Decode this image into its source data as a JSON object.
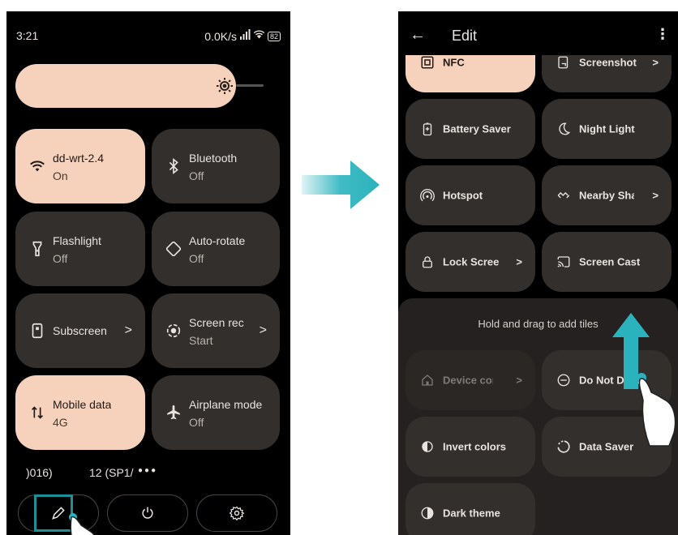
{
  "left_panel": {
    "status_time": "3:21",
    "status_speed": "0.0K/s",
    "battery": "82",
    "tiles": [
      {
        "title": "dd-wrt-2.4",
        "subtitle": "On",
        "icon": "wifi-icon",
        "active": true
      },
      {
        "title": "Bluetooth",
        "subtitle": "Off",
        "icon": "bluetooth-icon",
        "active": false
      },
      {
        "title": "Flashlight",
        "subtitle": "Off",
        "icon": "flashlight-icon",
        "active": false
      },
      {
        "title": "Auto-rotate",
        "subtitle": "Off",
        "icon": "auto-rotate-icon",
        "active": false
      },
      {
        "title": "Subscreen",
        "subtitle": "",
        "icon": "subscreen-icon",
        "active": false,
        "chevron": ">"
      },
      {
        "title": "Screen rec",
        "subtitle": "Start",
        "icon": "screen-record-icon",
        "active": false,
        "chevron": ">"
      },
      {
        "title": "Mobile data",
        "subtitle": "4G",
        "icon": "mobile-data-icon",
        "active": true
      },
      {
        "title": "Airplane mode",
        "subtitle": "Off",
        "icon": "airplane-icon",
        "active": false
      }
    ],
    "build_info_left": ")016)",
    "build_info_right": "12 (SP1/",
    "page_dots": "●●●"
  },
  "arrow_color": "#2bb3bd",
  "right_panel": {
    "title": "Edit",
    "back_icon": "back-arrow-icon",
    "menu_icon": "more-vert-icon",
    "tiles_active": [
      {
        "label": "NFC",
        "icon": "nfc-icon",
        "active": true
      },
      {
        "label": "Screenshot",
        "icon": "screenshot-icon",
        "chevron": ">"
      },
      {
        "label": "Battery Saver",
        "icon": "battery-saver-icon"
      },
      {
        "label": "Night Light",
        "icon": "night-light-icon"
      },
      {
        "label": "Hotspot",
        "icon": "hotspot-icon"
      },
      {
        "label": "Nearby Sha",
        "icon": "nearby-share-icon",
        "chevron": ">"
      },
      {
        "label": "Lock Scree",
        "icon": "lock-icon",
        "chevron": ">"
      },
      {
        "label": "Screen Cast",
        "icon": "screen-cast-icon"
      }
    ],
    "drag_hint": "Hold and drag to add tiles",
    "tiles_available": [
      {
        "label": "Device con",
        "icon": "device-controls-icon",
        "chevron": ">",
        "disabled": true
      },
      {
        "label": "Do Not Distu",
        "icon": "do-not-disturb-icon"
      },
      {
        "label": "Invert colors",
        "icon": "invert-colors-icon"
      },
      {
        "label": "Data Saver",
        "icon": "data-saver-icon"
      },
      {
        "label": "Dark theme",
        "icon": "dark-theme-icon"
      }
    ]
  }
}
